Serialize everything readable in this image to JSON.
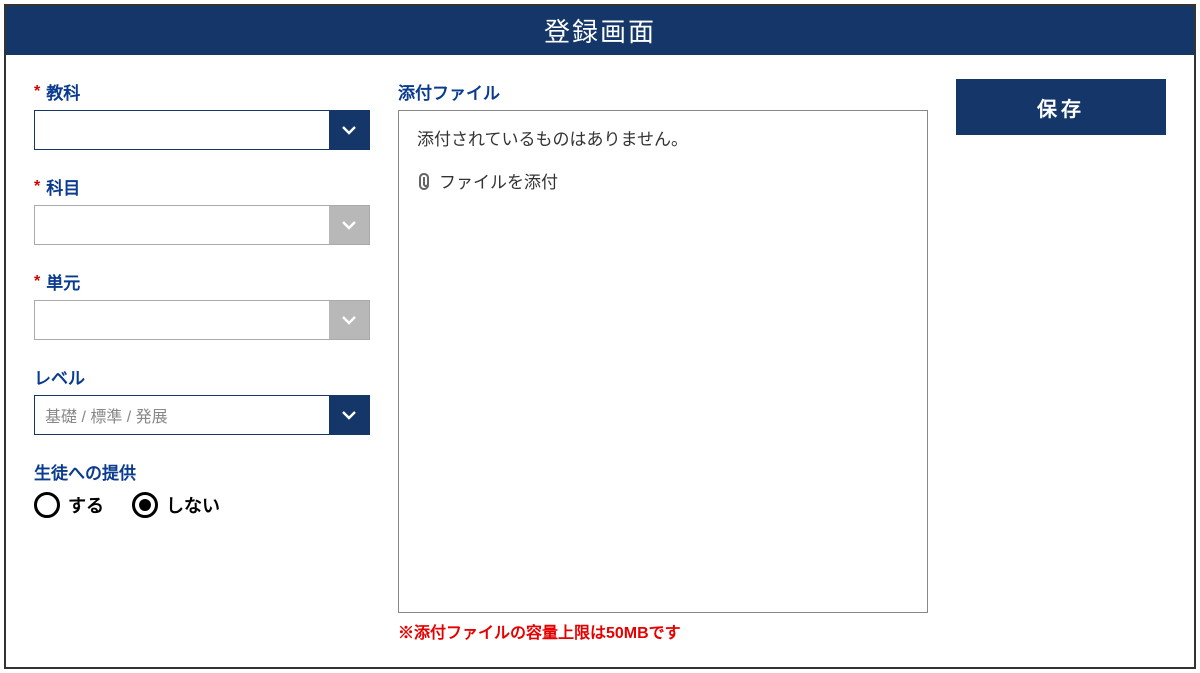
{
  "title": "登録画面",
  "left": {
    "subject": {
      "label": "教科",
      "required": true,
      "value": "",
      "enabled": true
    },
    "course": {
      "label": "科目",
      "required": true,
      "value": "",
      "enabled": false
    },
    "unit": {
      "label": "単元",
      "required": true,
      "value": "",
      "enabled": false
    },
    "level": {
      "label": "レベル",
      "required": false,
      "placeholder": "基礎 / 標準 / 発展",
      "enabled": true
    },
    "provision": {
      "label": "生徒への提供",
      "options": [
        {
          "label": "する",
          "checked": false
        },
        {
          "label": "しない",
          "checked": true
        }
      ]
    }
  },
  "attach": {
    "label": "添付ファイル",
    "empty_msg": "添付されているものはありません。",
    "action_label": "ファイルを添付",
    "note": "※添付ファイルの容量上限は50MBです"
  },
  "actions": {
    "save_label": "保存"
  }
}
